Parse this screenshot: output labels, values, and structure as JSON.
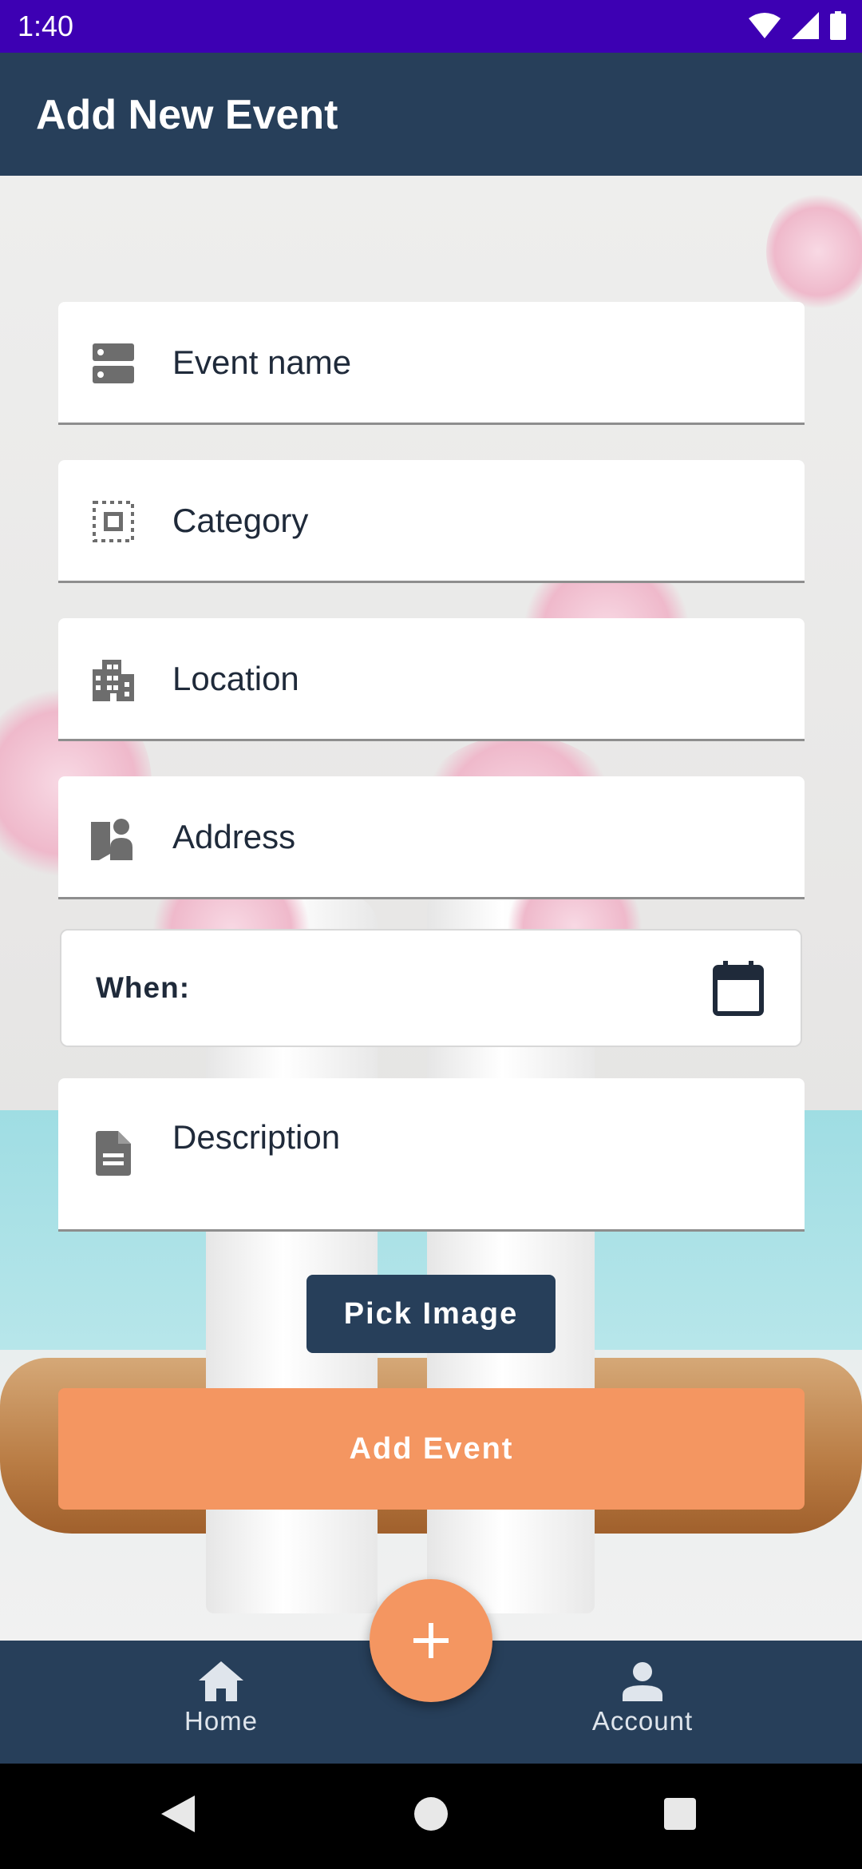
{
  "status_bar": {
    "time": "1:40"
  },
  "app_bar": {
    "title": "Add New Event"
  },
  "form": {
    "fields": [
      {
        "label": "Event name",
        "icon": "storage-icon"
      },
      {
        "label": "Category",
        "icon": "select-all-icon"
      },
      {
        "label": "Location",
        "icon": "apartment-icon"
      },
      {
        "label": "Address",
        "icon": "map-pin-person-icon"
      }
    ],
    "when_label": "When:",
    "description_label": "Description",
    "pick_image_label": "Pick Image",
    "add_event_label": "Add Event"
  },
  "bottom_nav": {
    "items": [
      {
        "label": "Home",
        "icon": "home-icon"
      },
      {
        "label": "Account",
        "icon": "person-icon"
      }
    ],
    "fab_icon": "plus-icon"
  },
  "colors": {
    "status_bar": "#3d00b3",
    "app_bar": "#273f5a",
    "accent": "#f49661",
    "field_bg": "#ffffff"
  }
}
